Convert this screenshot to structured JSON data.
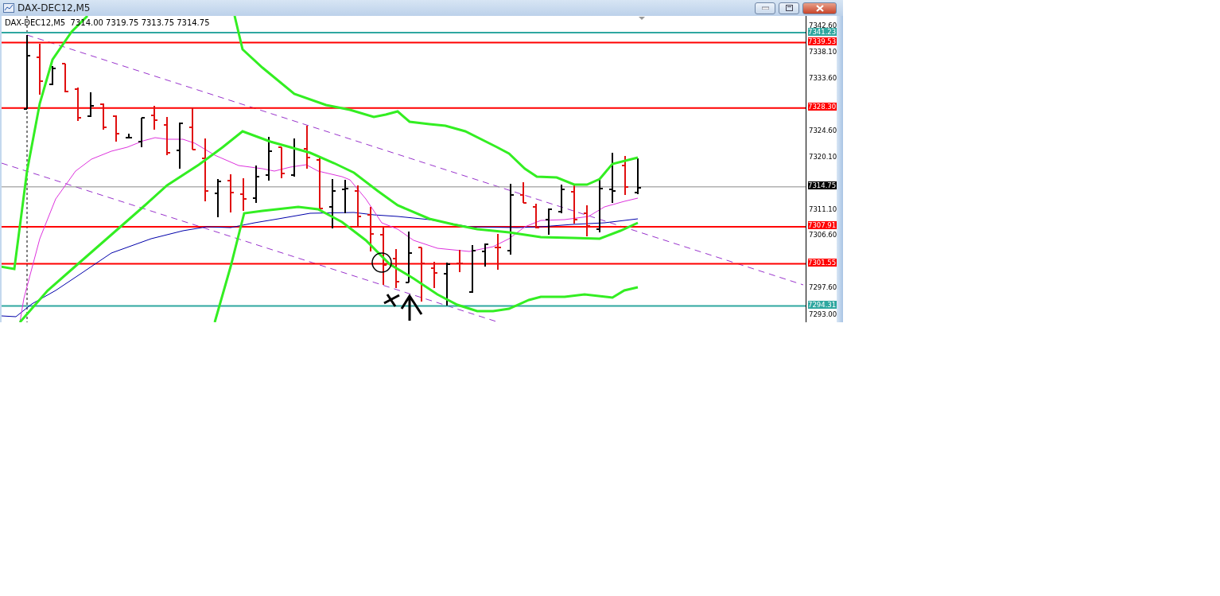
{
  "window": {
    "title": "DAX-DEC12,M5"
  },
  "chart": {
    "header": "DAX-DEC12,M5  7314.00 7319.75 7313.75 7314.75",
    "price_ticks": [
      {
        "label": "7342.60"
      },
      {
        "label": "7338.10"
      },
      {
        "label": "7333.60"
      },
      {
        "label": "7324.60"
      },
      {
        "label": "7320.10"
      },
      {
        "label": "7311.10"
      },
      {
        "label": "7306.60"
      },
      {
        "label": "7297.60"
      },
      {
        "label": "7293.00"
      }
    ],
    "levels": [
      {
        "label": "7341.23",
        "color": "#2fa7a0",
        "kind": "level"
      },
      {
        "label": "7339.53",
        "color": "#ff0000",
        "kind": "level"
      },
      {
        "label": "7328.30",
        "color": "#ff0000",
        "kind": "level"
      },
      {
        "label": "7314.75",
        "color": "#000000",
        "kind": "bid"
      },
      {
        "label": "7307.91",
        "color": "#ff0000",
        "kind": "level"
      },
      {
        "label": "7301.55",
        "color": "#ff0000",
        "kind": "level"
      },
      {
        "label": "7294.31",
        "color": "#2fa7a0",
        "kind": "level"
      }
    ]
  }
}
